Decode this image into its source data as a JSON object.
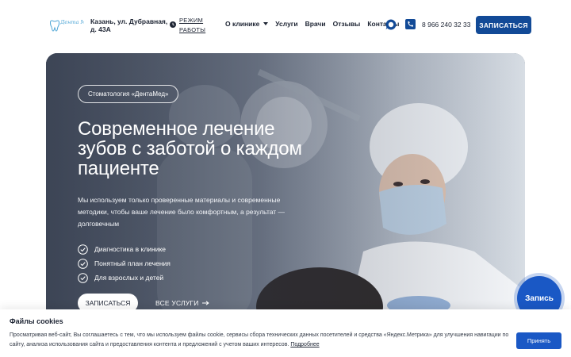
{
  "header": {
    "logo_text": "Дента Мед",
    "address": "Казань, ул. Дубравная, д. 43А",
    "hours_link": "РЕЖИМ РАБОТЫ",
    "nav": [
      {
        "label": "О клинике",
        "has_dropdown": true
      },
      {
        "label": "Услуги"
      },
      {
        "label": "Врачи"
      },
      {
        "label": "Отзывы"
      },
      {
        "label": "Контакты"
      }
    ],
    "phone": "8 966 240 32 33",
    "signup_label": "ЗАПИСАТЬСЯ",
    "icons": [
      "clock-icon",
      "chevron-down-icon",
      "chat-icon",
      "phone-icon"
    ]
  },
  "hero": {
    "badge": "Стоматология «ДентаМед»",
    "title": "Современное лечение зубов с заботой о каждом пациенте",
    "description": "Мы используем только проверенные материалы и современные методики, чтобы ваше лечение было комфортным, а результат — долговечным",
    "features": [
      "Диагностика в клинике",
      "Понятный план лечения",
      "Для взрослых и детей"
    ],
    "signup_label": "ЗАПИСАТЬСЯ",
    "all_services_label": "ВСЕ УСЛУГИ"
  },
  "floating_button": {
    "label": "Запись"
  },
  "cookie": {
    "title": "Файлы cookies",
    "text": "Просматривая веб-сайт, Вы соглашаетесь с тем, что мы используем файлы cookie, сервисы сбора технических данных посетителей и средства «Яндекс.Метрика» для улучшения навигации по сайту, анализа использования сайта и предоставления контента и предложений с учетом ваших интересов.",
    "link": "Подробнее",
    "accept_label": "Принять"
  },
  "colors": {
    "brand": "#124a97",
    "accent": "#1a58c5",
    "text": "#1d2433"
  }
}
